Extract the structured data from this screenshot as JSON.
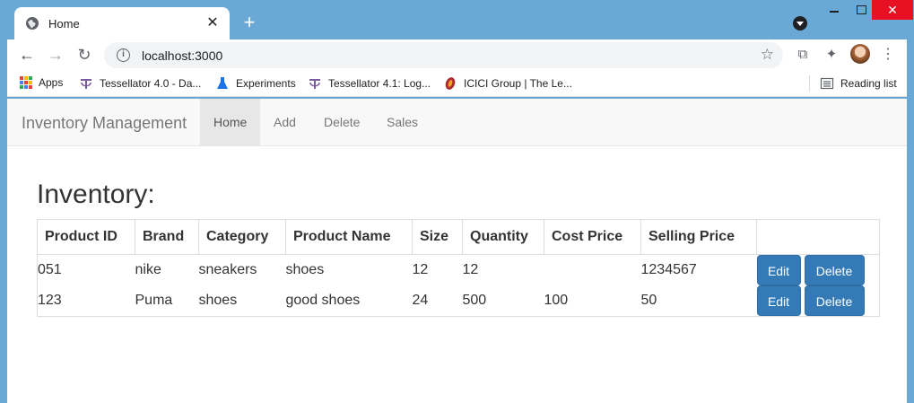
{
  "browser": {
    "tab_title": "Home",
    "new_tab_label": "+",
    "address": "localhost:3000",
    "info_glyph": "i",
    "bookmarks": [
      {
        "label": "Apps",
        "icon": "apps-grid-icon"
      },
      {
        "label": "Tessellator 4.0 - Da...",
        "icon": "tessellator-icon"
      },
      {
        "label": "Experiments",
        "icon": "flask-icon"
      },
      {
        "label": "Tessellator 4.1: Log...",
        "icon": "tessellator-icon"
      },
      {
        "label": "ICICI Group | The Le...",
        "icon": "icici-icon"
      }
    ],
    "reading_list": "Reading list"
  },
  "app": {
    "brand": "Inventory Management",
    "nav": [
      {
        "label": "Home",
        "active": true
      },
      {
        "label": "Add",
        "active": false
      },
      {
        "label": "Delete",
        "active": false
      },
      {
        "label": "Sales",
        "active": false
      }
    ],
    "heading": "Inventory:",
    "table": {
      "columns": [
        "Product ID",
        "Brand",
        "Category",
        "Product Name",
        "Size",
        "Quantity",
        "Cost Price",
        "Selling Price",
        ""
      ],
      "rows": [
        {
          "id": "051",
          "brand": "nike",
          "category": "sneakers",
          "name": "shoes",
          "size": "12",
          "quantity": "12",
          "cost": "",
          "selling": "1234567"
        },
        {
          "id": "123",
          "brand": "Puma",
          "category": "shoes",
          "name": "good shoes",
          "size": "24",
          "quantity": "500",
          "cost": "100",
          "selling": "50"
        }
      ],
      "edit_label": "Edit",
      "delete_label": "Delete"
    }
  },
  "colors": {
    "window_frame": "#6aa8d6",
    "button_primary": "#337ab7",
    "close_button": "#e81123"
  }
}
